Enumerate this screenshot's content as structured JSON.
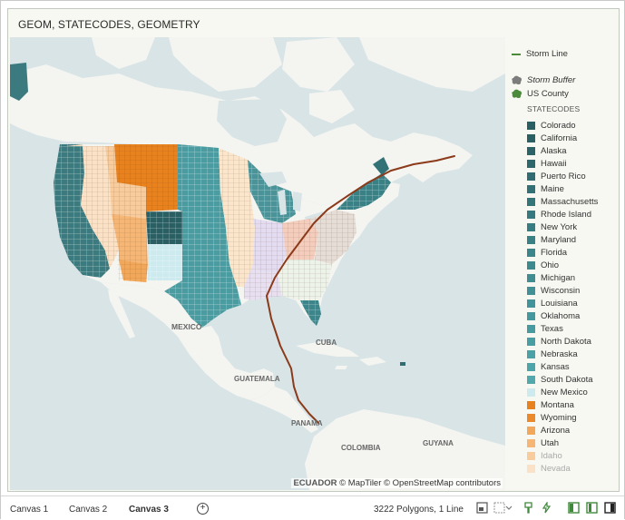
{
  "panel": {
    "title": "GEOM, STATECODES, GEOMETRY"
  },
  "map": {
    "labels": {
      "mexico": "MEXICO",
      "cuba": "CUBA",
      "guatemala": "GUATEMALA",
      "panama": "PANAMA",
      "colombia": "COLOMBIA",
      "guyana": "GUYANA"
    },
    "attribution": {
      "ecuador": "ECUADOR",
      "credits": "© MapTiler © OpenStreetMap contributors"
    },
    "colors": {
      "water": "#d8e4e6",
      "land": "#f4f4f1",
      "storm_line": "#8b3a1a"
    }
  },
  "legend": {
    "storm_line": "Storm Line",
    "storm_buffer": "Storm Buffer",
    "us_county": "US County",
    "statecodes_title": "STATECODES",
    "states": [
      {
        "name": "Colorado",
        "color": "#2a5f63"
      },
      {
        "name": "California",
        "color": "#2a5f63"
      },
      {
        "name": "Alaska",
        "color": "#2c6368"
      },
      {
        "name": "Hawaii",
        "color": "#2e686c"
      },
      {
        "name": "Puerto Rico",
        "color": "#306c71"
      },
      {
        "name": "Maine",
        "color": "#327176"
      },
      {
        "name": "Massachusetts",
        "color": "#34757a"
      },
      {
        "name": "Rhode Island",
        "color": "#36797e"
      },
      {
        "name": "New York",
        "color": "#387d82"
      },
      {
        "name": "Maryland",
        "color": "#3a8186"
      },
      {
        "name": "Florida",
        "color": "#3c858a"
      },
      {
        "name": "Ohio",
        "color": "#3e898e"
      },
      {
        "name": "Michigan",
        "color": "#408d92"
      },
      {
        "name": "Wisconsin",
        "color": "#429196"
      },
      {
        "name": "Louisiana",
        "color": "#43949a"
      },
      {
        "name": "Oklahoma",
        "color": "#45989d"
      },
      {
        "name": "Texas",
        "color": "#479ba0"
      },
      {
        "name": "North Dakota",
        "color": "#499ea3"
      },
      {
        "name": "Nebraska",
        "color": "#4ba1a6"
      },
      {
        "name": "Kansas",
        "color": "#4da4a9"
      },
      {
        "name": "South Dakota",
        "color": "#52a8ad"
      },
      {
        "name": "New Mexico",
        "color": "#cdeaef"
      },
      {
        "name": "Montana",
        "color": "#e8821e"
      },
      {
        "name": "Wyoming",
        "color": "#ea8a2a"
      },
      {
        "name": "Arizona",
        "color": "#f2a85a"
      },
      {
        "name": "Utah",
        "color": "#f5b676"
      },
      {
        "name": "Idaho",
        "color": "#f8cc9c"
      },
      {
        "name": "Nevada",
        "color": "#fbe2c6"
      }
    ]
  },
  "bottom": {
    "tabs": [
      "Canvas 1",
      "Canvas 2",
      "Canvas 3"
    ],
    "add_tab": "+",
    "status": "3222 Polygons, 1 Line"
  }
}
